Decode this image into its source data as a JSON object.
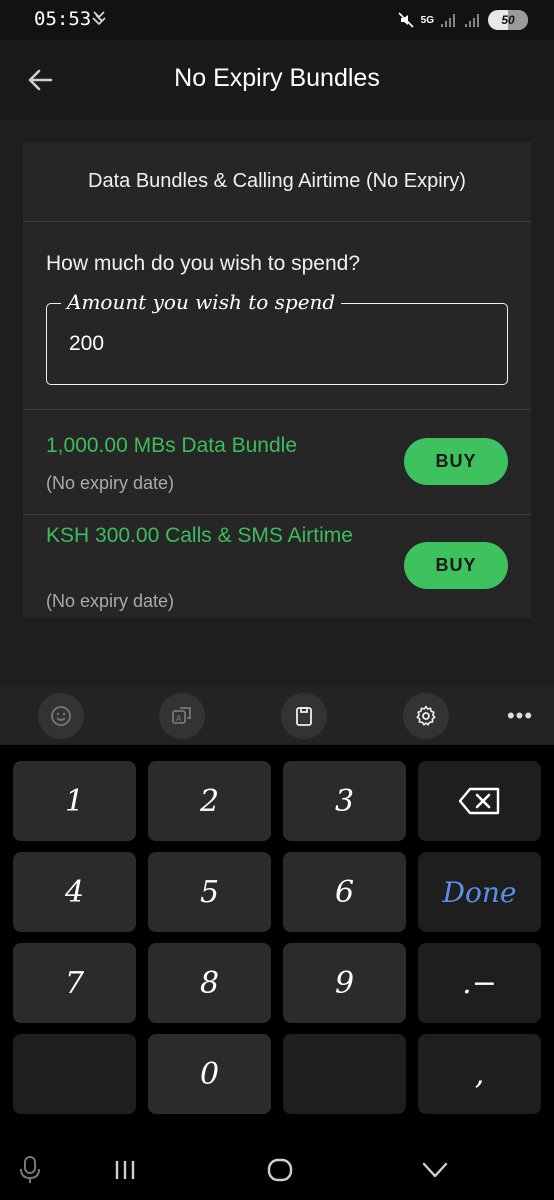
{
  "status_bar": {
    "time": "05:53",
    "network": "5G",
    "battery": "50"
  },
  "app_bar": {
    "title": "No Expiry Bundles"
  },
  "card": {
    "header": "Data Bundles & Calling Airtime (No Expiry)",
    "question": "How much do you wish to spend?",
    "amount_label": "Amount you wish to spend",
    "amount_value": "200",
    "offers": [
      {
        "title": "1,000.00 MBs Data Bundle",
        "subtitle": "(No expiry date)",
        "button": "BUY"
      },
      {
        "title": "KSH 300.00 Calls & SMS Airtime",
        "subtitle": "(No expiry date)",
        "button": "BUY"
      }
    ]
  },
  "keyboard_toolbar": {
    "icons": [
      "emoji-icon",
      "translate-icon",
      "clipboard-icon",
      "settings-icon",
      "more-icon"
    ],
    "more_label": "•••"
  },
  "keyboard": {
    "keys": {
      "k1": "1",
      "k2": "2",
      "k3": "3",
      "k4": "4",
      "k5": "5",
      "k6": "6",
      "done": "Done",
      "k7": "7",
      "k8": "8",
      "k9": "9",
      "dot_dash": ".−",
      "k0": "0",
      "comma": ","
    }
  },
  "colors": {
    "accent_green": "#3ec25d",
    "offer_text_green": "#3cbd5a",
    "done_blue": "#5b8fe8",
    "background": "#1a1a1a"
  }
}
